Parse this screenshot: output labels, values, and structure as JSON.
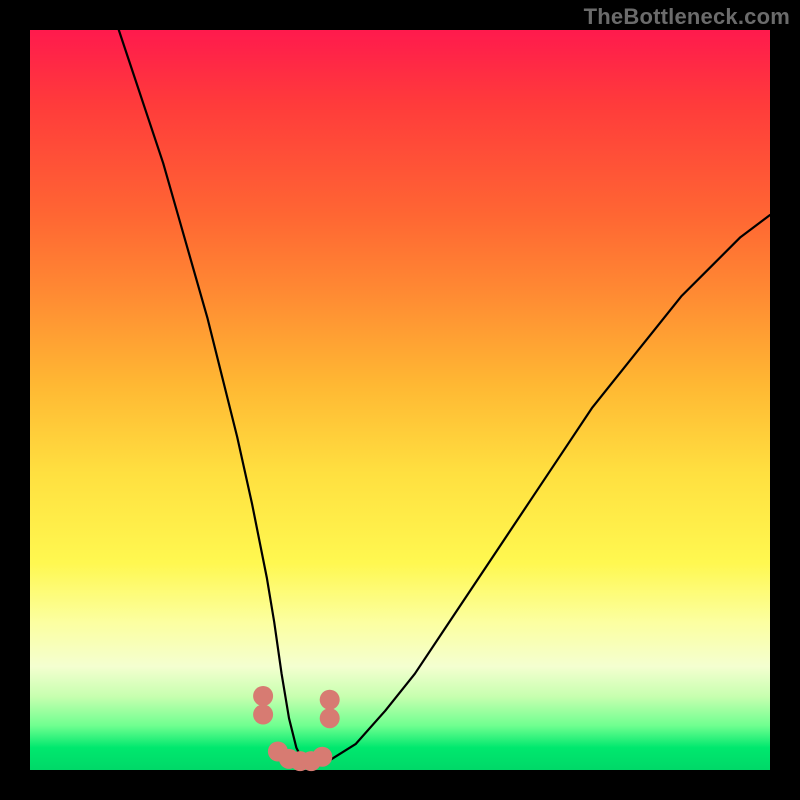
{
  "watermark": "TheBottleneck.com",
  "chart_data": {
    "type": "line",
    "title": "",
    "xlabel": "",
    "ylabel": "",
    "xlim": [
      0,
      100
    ],
    "ylim": [
      0,
      100
    ],
    "series": [
      {
        "name": "bottleneck-curve",
        "x": [
          12,
          14,
          16,
          18,
          20,
          22,
          24,
          26,
          28,
          30,
          32,
          33,
          34,
          35,
          36,
          37,
          38,
          40,
          44,
          48,
          52,
          56,
          60,
          64,
          68,
          72,
          76,
          80,
          84,
          88,
          92,
          96,
          100
        ],
        "values": [
          100,
          94,
          88,
          82,
          75,
          68,
          61,
          53,
          45,
          36,
          26,
          20,
          13,
          7,
          3,
          1,
          0.5,
          1,
          3.5,
          8,
          13,
          19,
          25,
          31,
          37,
          43,
          49,
          54,
          59,
          64,
          68,
          72,
          75
        ]
      }
    ],
    "markers": {
      "name": "highlight-dots",
      "color": "#d77b72",
      "x": [
        31.5,
        31.5,
        33.5,
        35.0,
        36.5,
        38.0,
        39.5,
        40.5,
        40.5
      ],
      "values": [
        10.0,
        7.5,
        2.5,
        1.5,
        1.2,
        1.2,
        1.8,
        7.0,
        9.5
      ],
      "size": [
        10,
        10,
        10,
        10,
        10,
        10,
        10,
        10,
        10
      ]
    },
    "background_gradient": {
      "top": "#ff1a4d",
      "bottom": "#00d868"
    }
  }
}
